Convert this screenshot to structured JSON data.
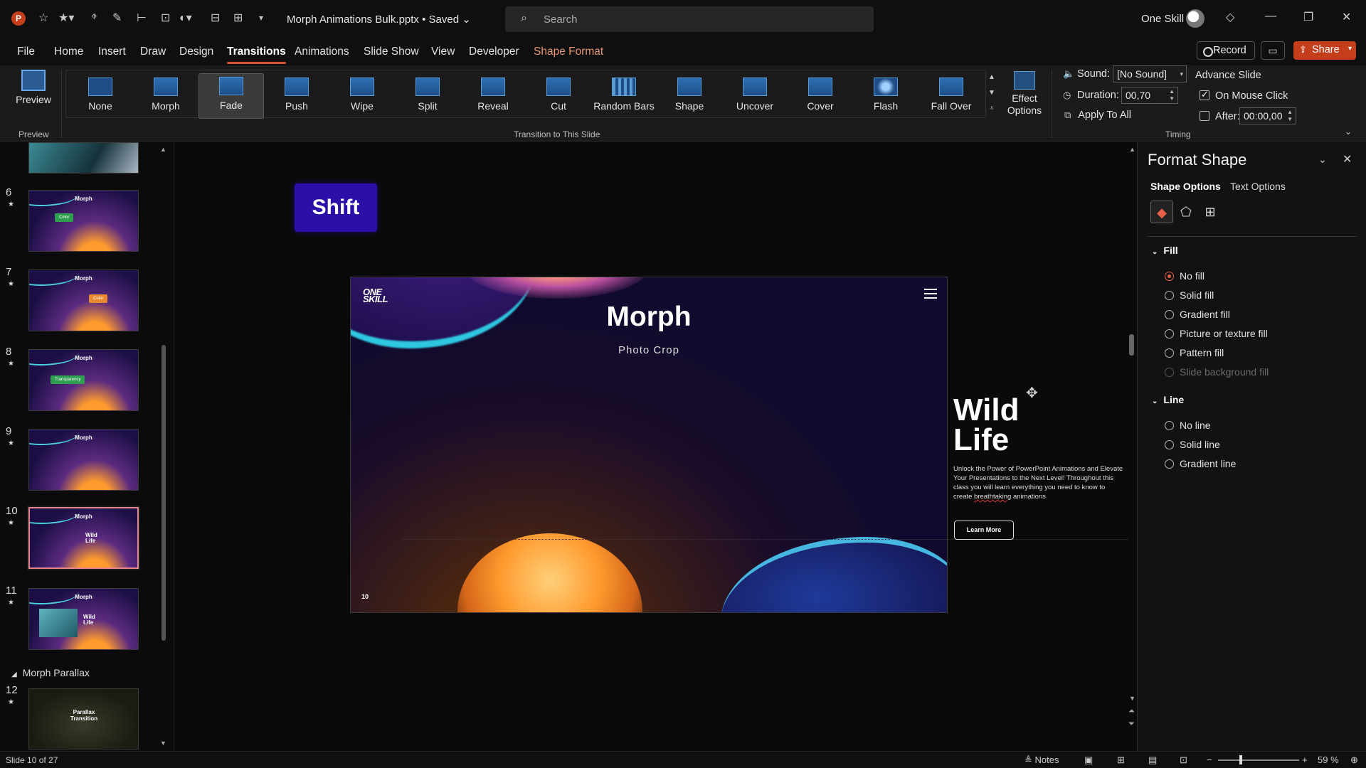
{
  "titlebar": {
    "app_logo": "P",
    "doc_title": "Morph Animations Bulk.pptx • Saved",
    "search_placeholder": "Search",
    "user_name": "One Skill",
    "window_controls": [
      "minimize-icon",
      "restore-icon",
      "close-icon"
    ]
  },
  "menu": {
    "tabs": [
      "File",
      "Home",
      "Insert",
      "Draw",
      "Design",
      "Transitions",
      "Animations",
      "Slide Show",
      "View",
      "Developer",
      "Shape Format"
    ],
    "active_tab": "Transitions",
    "record_label": "Record",
    "share_label": "Share"
  },
  "ribbon": {
    "preview_label": "Preview",
    "preview_group": "Preview",
    "transitions": [
      "None",
      "Morph",
      "Fade",
      "Push",
      "Wipe",
      "Split",
      "Reveal",
      "Cut",
      "Random Bars",
      "Shape",
      "Uncover",
      "Cover",
      "Flash",
      "Fall Over"
    ],
    "selected_transition": "Fade",
    "transition_group": "Transition to This Slide",
    "effect_options_label": "Effect Options",
    "timing": {
      "sound_label": "Sound:",
      "sound_value": "[No Sound]",
      "duration_label": "Duration:",
      "duration_value": "00,70",
      "apply_all_label": "Apply To All",
      "advance_label": "Advance Slide",
      "on_mouse_click_label": "On Mouse Click",
      "on_mouse_click_checked": true,
      "after_label": "After:",
      "after_value": "00:00,00",
      "after_checked": false,
      "group_label": "Timing"
    }
  },
  "thumbnails": {
    "slides": [
      {
        "num": "6",
        "title": "Morph",
        "badge": "Color",
        "badge_color": "#2e9e4f"
      },
      {
        "num": "7",
        "title": "Morph",
        "badge": "Color",
        "badge_color": "#e8892e"
      },
      {
        "num": "8",
        "title": "Morph",
        "badge": "Transparency",
        "badge_color": "#2e9e4f"
      },
      {
        "num": "9",
        "title": "Morph",
        "badge": "",
        "badge_color": ""
      },
      {
        "num": "10",
        "title": "Morph",
        "badge": "",
        "badge_color": "",
        "wild": "Wild Life",
        "selected": true
      },
      {
        "num": "11",
        "title": "Morph",
        "badge": "",
        "badge_color": "",
        "wild": "Wild Life"
      },
      {
        "num": "12",
        "title": "Parallax Transition",
        "badge": "",
        "badge_color": ""
      }
    ],
    "section_label": "Morph Parallax"
  },
  "canvas": {
    "shift_badge": "Shift",
    "slide_logo": "ONE SKILL",
    "slide_title": "Morph",
    "slide_subtitle": "Photo Crop",
    "slide_number": "10",
    "offslide_title_line1": "Wild",
    "offslide_title_line2": "Life",
    "offslide_body_pre": "Unlock the Power of PowerPoint Animations and Elevate Your Presentations to the Next Level! Throughout this class you will learn everything you need to know to create ",
    "offslide_body_squiggle": "breathtaking",
    "offslide_body_post": " animations",
    "learn_more": "Learn More"
  },
  "format_pane": {
    "title": "Format Shape",
    "tabs": [
      "Shape Options",
      "Text Options"
    ],
    "active_tab": "Shape Options",
    "icons": [
      "fill-line-icon",
      "effects-pentagon-icon",
      "size-properties-icon"
    ],
    "fill_section": "Fill",
    "fill_options": [
      "No fill",
      "Solid fill",
      "Gradient fill",
      "Picture or texture fill",
      "Pattern fill",
      "Slide background fill"
    ],
    "fill_selected": "No fill",
    "line_section": "Line",
    "line_options": [
      "No line",
      "Solid line",
      "Gradient line"
    ]
  },
  "statusbar": {
    "slide_info": "Slide 10 of 27",
    "notes_label": "Notes",
    "zoom_level": "59 %"
  },
  "colors": {
    "accent": "#d35230",
    "share_bg": "#c43e1c",
    "shift_badge_bg": "#2b0fa8",
    "selected_thumb_border": "#e8858c"
  }
}
